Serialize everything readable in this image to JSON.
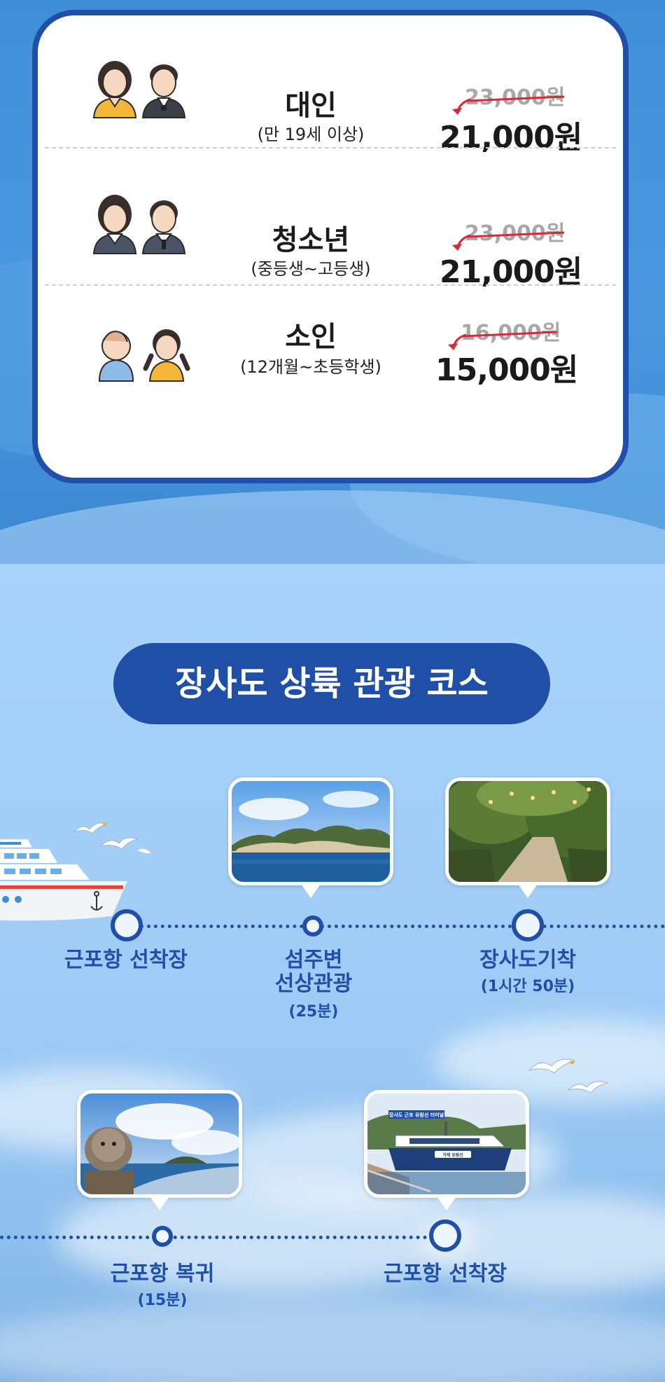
{
  "pricing": {
    "rows": [
      {
        "category": "대인",
        "condition": "(만 19세 이상)",
        "original_price": "23,000원",
        "discount_price": "21,000원",
        "icon": "adult-couple-icon"
      },
      {
        "category": "청소년",
        "condition": "(중등생~고등생)",
        "original_price": "23,000원",
        "discount_price": "21,000원",
        "icon": "teen-couple-icon"
      },
      {
        "category": "소인",
        "condition": "(12개월~초등학생)",
        "original_price": "16,000원",
        "discount_price": "15,000원",
        "icon": "children-icon"
      }
    ]
  },
  "course": {
    "title": "장사도 상륙 관광 코스",
    "stops": [
      {
        "name": "근포항 선착장",
        "duration": ""
      },
      {
        "name": "섬주변\n선상관광",
        "duration": "(25분)"
      },
      {
        "name": "장사도기착",
        "duration": "(1시간 50분)"
      },
      {
        "name": "근포항 복귀",
        "duration": "(15분)"
      },
      {
        "name": "근포항 선착장",
        "duration": ""
      }
    ],
    "photos": [
      "island-coast-photo",
      "garden-path-photo",
      "ferry-wake-photo",
      "docked-ferry-photo"
    ],
    "ferry_sign": "장사도 근포 유람선 터미널",
    "ferry_name": "거제 유람선"
  },
  "colors": {
    "brand_blue": "#1f4fa6",
    "strike_red": "#d8283a",
    "sky_blue": "#9ecbf5"
  }
}
